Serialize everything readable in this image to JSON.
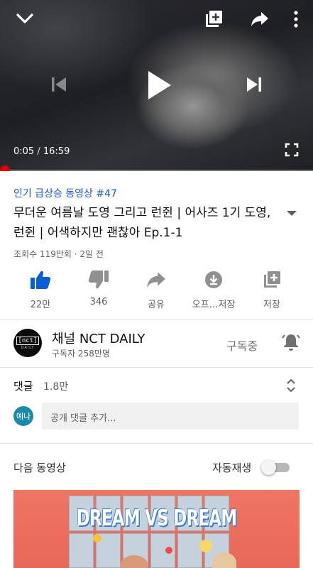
{
  "player": {
    "current_time": "0:05",
    "separator": "/",
    "duration": "16:59",
    "progress_fraction": 0.005,
    "icons": [
      "chevron-down-icon",
      "add-to-playlist-icon",
      "share-icon",
      "more-vert-icon",
      "skip-previous-icon",
      "play-icon",
      "skip-next-icon",
      "fullscreen-icon"
    ]
  },
  "video": {
    "hashtag": "인기 급상승 동영상 #47",
    "title": "무더운 여름날 도영 그리고 런쥔 | 어사즈 1기 도영, 런쥔 | 어색하지만 괜찮아 Ep.1-1",
    "meta": "조회수 119만회 · 2일 전"
  },
  "actions": [
    {
      "icon": "thumbs-up-icon",
      "label": "22만"
    },
    {
      "icon": "thumbs-down-icon",
      "label": "346"
    },
    {
      "icon": "share-icon",
      "label": "공유"
    },
    {
      "icon": "download-icon",
      "label": "오프…저장"
    },
    {
      "icon": "add-to-playlist-icon",
      "label": "저장"
    }
  ],
  "channel": {
    "avatar_text_top": "[nct]",
    "avatar_text_bottom": "DAILY",
    "name": "채널 NCT DAILY",
    "subscribers": "구독자 258만명",
    "subscribed_label": "구독중"
  },
  "comments": {
    "label": "댓글",
    "count": "1.8만",
    "user_avatar_text": "예나",
    "placeholder": "공개 댓글 추가..."
  },
  "up_next": {
    "label": "다음 동영상",
    "autoplay_label": "자동재생",
    "autoplay_on": false,
    "thumbnail_title": "DREAM VS DREAM"
  },
  "colors": {
    "accent_blue": "#065fd4",
    "progress_red": "#ff0000",
    "thumbnail_bg": "#eb6e5e"
  }
}
